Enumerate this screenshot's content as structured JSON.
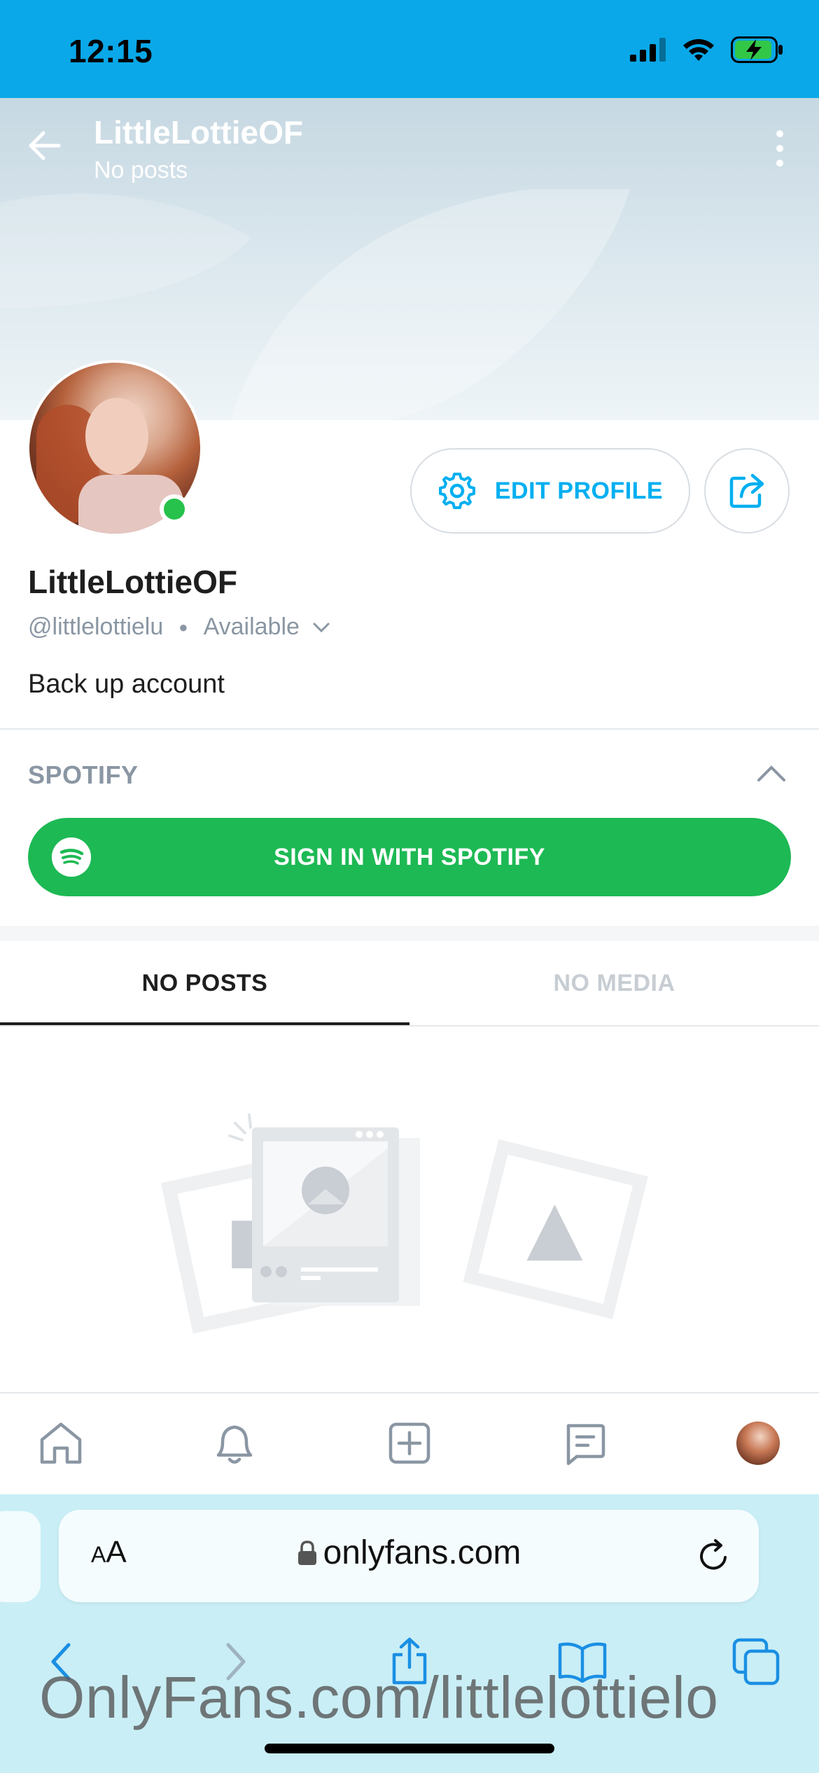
{
  "status_bar": {
    "time": "12:15",
    "icons": [
      "cellular-signal-icon",
      "wifi-icon",
      "battery-charging-icon"
    ]
  },
  "header": {
    "title": "LittleLottieOF",
    "subtitle": "No posts",
    "icons": [
      "back-arrow-icon",
      "more-vertical-icon"
    ]
  },
  "profile": {
    "display_name": "LittleLottieOF",
    "username": "@littlelottielu",
    "availability": "Available",
    "bio": "Back up account",
    "online": true,
    "edit_button_label": "EDIT PROFILE",
    "icons": [
      "gear-icon",
      "share-icon",
      "chevron-down-icon"
    ]
  },
  "spotify": {
    "section_title": "SPOTIFY",
    "sign_in_label": "SIGN IN WITH SPOTIFY",
    "icons": [
      "spotify-logo-icon",
      "chevron-up-icon"
    ]
  },
  "tabs": [
    {
      "label": "NO POSTS",
      "active": true
    },
    {
      "label": "NO MEDIA",
      "active": false
    }
  ],
  "bottom_nav": {
    "items": [
      "home-icon",
      "notifications-bell-icon",
      "add-post-icon",
      "messages-icon",
      "profile-avatar"
    ]
  },
  "browser": {
    "text_size_label_small": "A",
    "text_size_label_large": "A",
    "url": "onlyfans.com",
    "icons": [
      "lock-icon",
      "reload-icon",
      "back-chevron-icon",
      "forward-chevron-icon",
      "share-icon",
      "bookmarks-icon",
      "tabs-icon"
    ]
  },
  "watermark": "OnlyFans.com/littlelottielo",
  "colors": {
    "status_bar": "#0aa8e8",
    "accent": "#00aff0",
    "spotify_green": "#1db954",
    "online_green": "#26c24b",
    "safari_toolbar": "#c9eef6"
  }
}
